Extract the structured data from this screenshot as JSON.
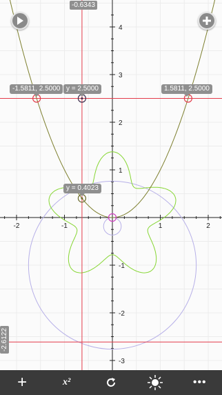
{
  "graph": {
    "x_range": [
      -2.3,
      2.3
    ],
    "y_range": [
      -3.1,
      4.3
    ],
    "x_ticks": [
      "-2",
      "-1",
      "1",
      "2"
    ],
    "y_ticks": [
      "4",
      "3",
      "2",
      "1",
      "-1",
      "-2",
      "-3"
    ],
    "curves": [
      {
        "name": "parabola",
        "color": "#7d7f2e"
      },
      {
        "name": "flower",
        "color": "#86d633"
      },
      {
        "name": "circle",
        "color": "#b7b0e8"
      }
    ],
    "trace_color": "#e33b4a"
  },
  "readouts": {
    "x_pill": "-0.6343",
    "y_pill": "-2.6122",
    "left_point": "-1.5811, 2.5000",
    "trace_point": "y = 2.5000",
    "right_point": "1.5811, 2.5000",
    "lower_trace": "y = 0.4023"
  },
  "toolbar": {
    "add": "+",
    "function": "x²",
    "redo": "redo",
    "brightness": "brightness",
    "more": "•••"
  }
}
